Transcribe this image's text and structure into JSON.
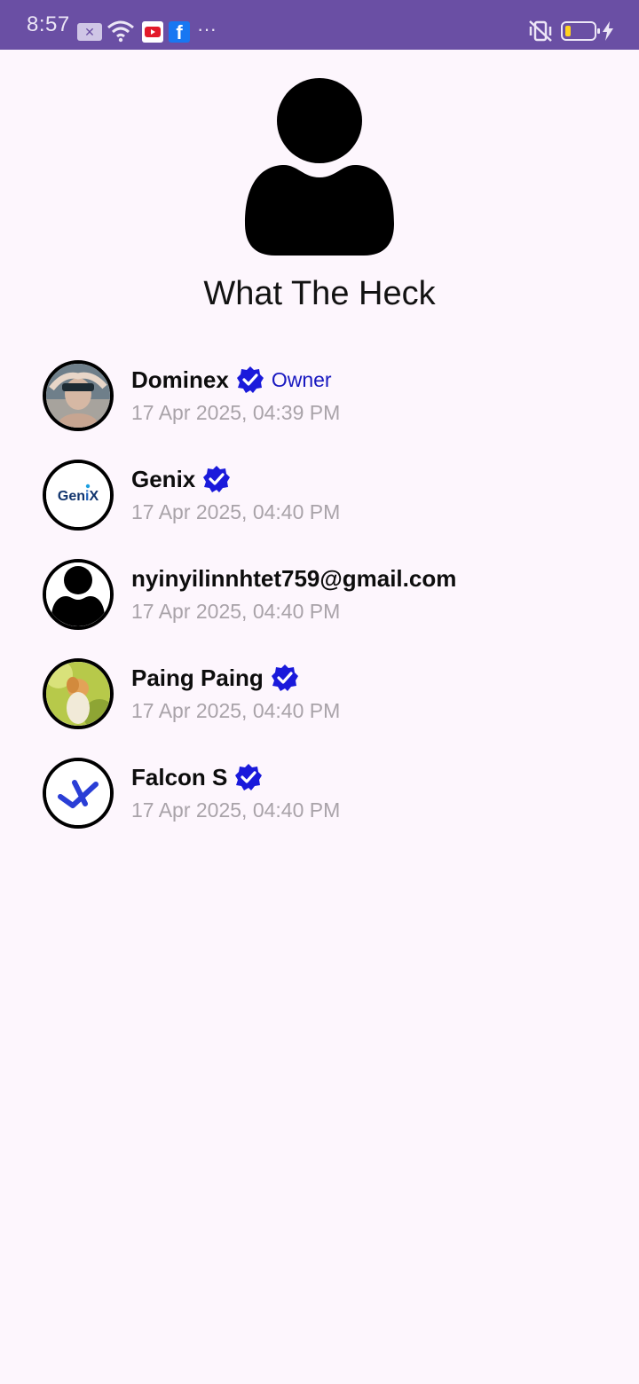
{
  "status_bar": {
    "time": "8:57",
    "notification_icons": [
      "x-badge-icon",
      "wifi-icon",
      "youtube-icon",
      "facebook-icon",
      "more-dots-icon"
    ],
    "right_icons": [
      "vibrate-off-icon",
      "battery-icon",
      "charging-bolt-icon"
    ],
    "overflow": "···",
    "fb_letter": "f"
  },
  "group": {
    "avatar_icon": "person-silhouette-icon",
    "title": "What The Heck"
  },
  "members": [
    {
      "name": "Dominex",
      "verified": true,
      "role": "Owner",
      "joined": "17 Apr 2025, 04:39 PM",
      "avatar": "photo-person-icon"
    },
    {
      "name": "Genix",
      "verified": true,
      "role": "",
      "joined": "17 Apr 2025, 04:40 PM",
      "avatar": "genix-logo-icon"
    },
    {
      "name": "nyinyilinnhtet759@gmail.com",
      "verified": false,
      "role": "",
      "joined": "17 Apr 2025, 04:40 PM",
      "avatar": "person-silhouette-icon"
    },
    {
      "name": "Paing Paing",
      "verified": true,
      "role": "",
      "joined": "17 Apr 2025, 04:40 PM",
      "avatar": "photo-anime-icon"
    },
    {
      "name": "Falcon S",
      "verified": true,
      "role": "",
      "joined": "17 Apr 2025, 04:40 PM",
      "avatar": "falcon-logo-icon"
    }
  ],
  "colors": {
    "status_bar": "#6a4fa4",
    "background": "#fdf6fd",
    "verified_badge": "#1a1adb",
    "role_text": "#1818c0",
    "date_text": "#a9a3a9"
  }
}
